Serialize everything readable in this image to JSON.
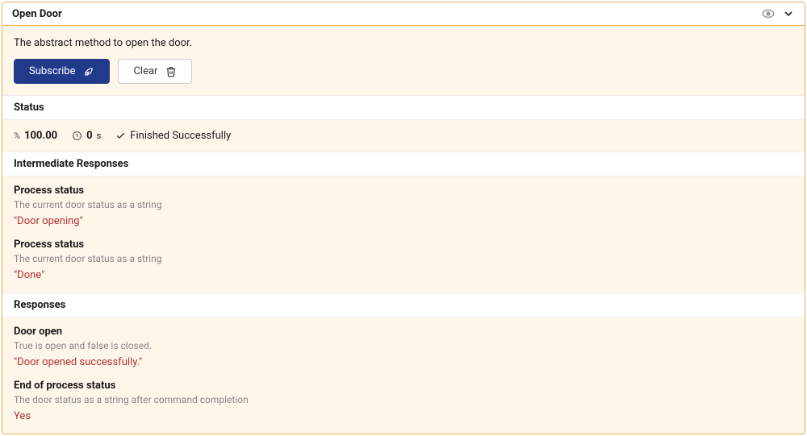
{
  "header": {
    "title": "Open Door"
  },
  "description": "The abstract method to open the door.",
  "buttons": {
    "subscribe": "Subscribe",
    "clear": "Clear"
  },
  "sections": {
    "status": "Status",
    "intermediate": "Intermediate Responses",
    "responses": "Responses"
  },
  "status": {
    "percent": "100.00",
    "duration_value": "0",
    "duration_unit": "s",
    "result": "Finished Successfully"
  },
  "intermediate": [
    {
      "title": "Process status",
      "desc": "The current door status as a string",
      "value": "\"Door opening\""
    },
    {
      "title": "Process status",
      "desc": "The current door status as a string",
      "value": "\"Done\""
    }
  ],
  "responses": [
    {
      "title": "Door open",
      "desc": "True is open and false is closed.",
      "value": "\"Door opened successfully.\""
    },
    {
      "title": "End of process status",
      "desc": "The door status as a string after command completion",
      "value": "Yes"
    }
  ]
}
